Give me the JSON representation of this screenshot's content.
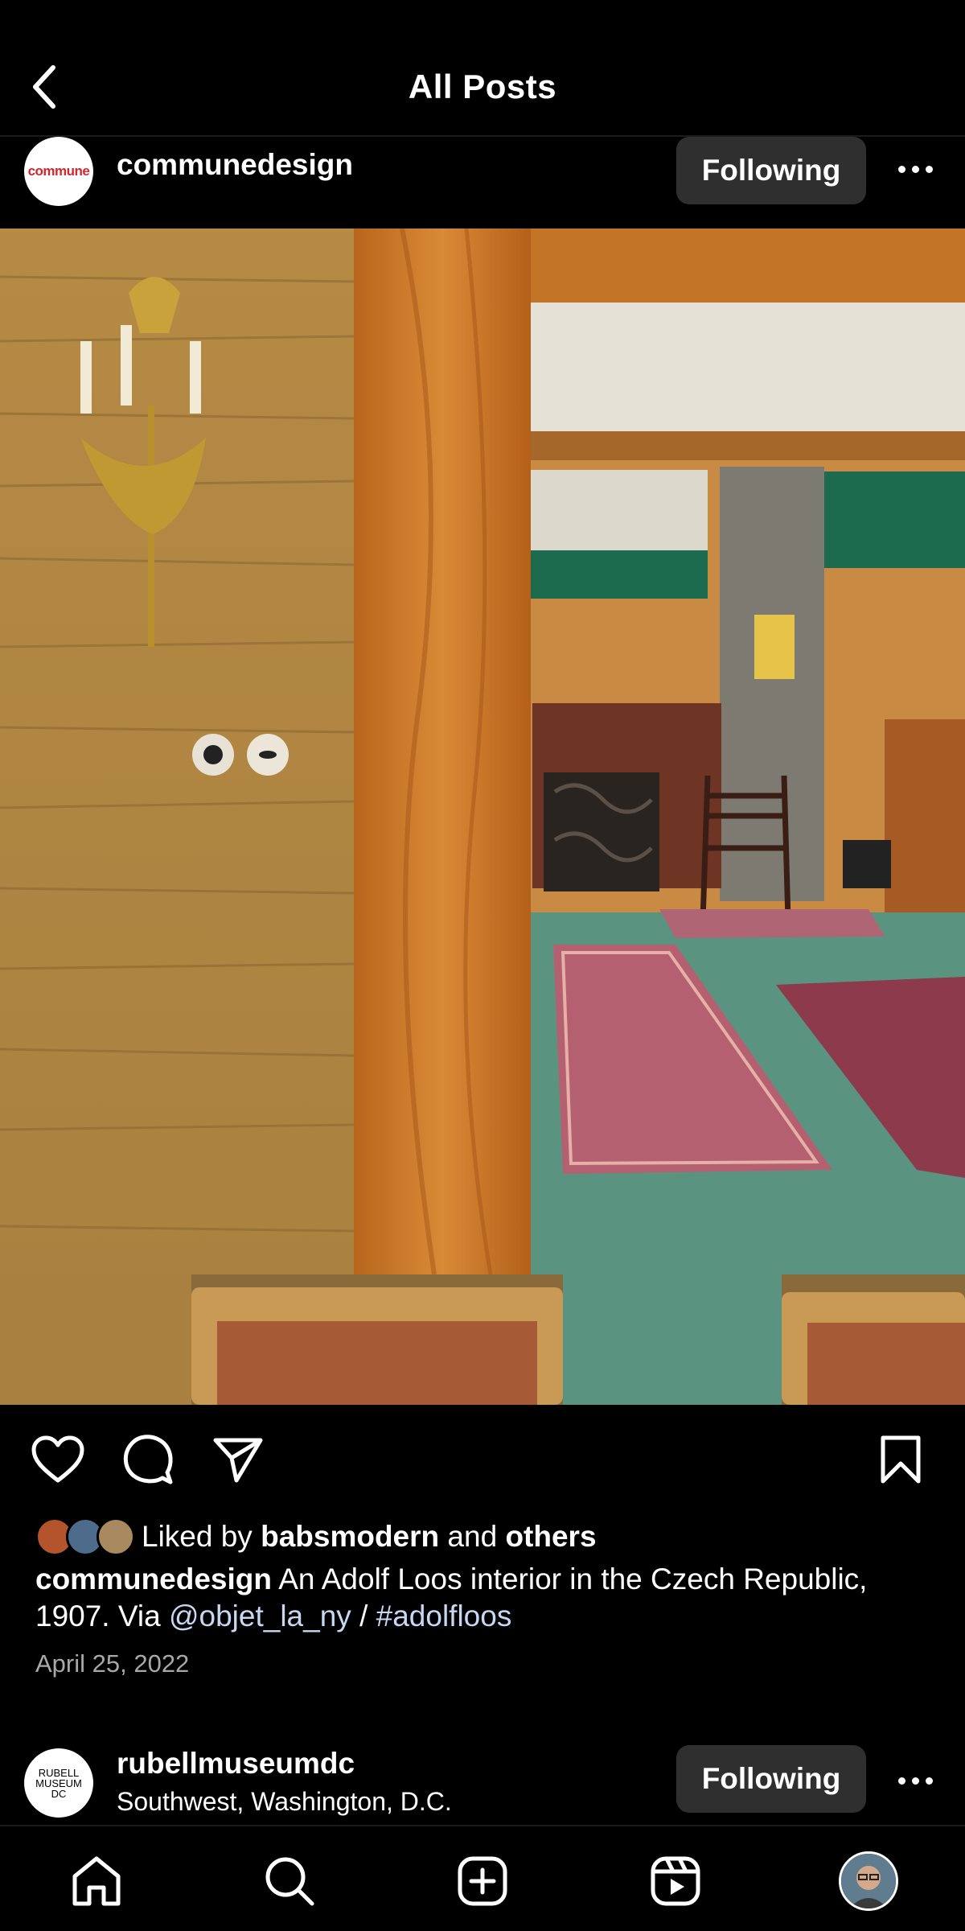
{
  "header": {
    "title": "All Posts"
  },
  "post": {
    "username": "communedesign",
    "avatar_text": "commune",
    "follow_label": "Following",
    "likes": {
      "prefix": "Liked by",
      "user": "babsmodern",
      "joiner": "and",
      "others": "others"
    },
    "caption": {
      "username": "communedesign",
      "text": "An Adolf Loos interior in the Czech Republic, 1907. Via",
      "mention": "@objet_la_ny",
      "separator": "/",
      "hashtag": "#adolfloos"
    },
    "date": "April 25, 2022"
  },
  "next_post": {
    "username": "rubellmuseumdc",
    "location": "Southwest, Washington, D.C.",
    "follow_label": "Following",
    "avatar_lines": [
      "RUBELL",
      "MUSEUM",
      "DC"
    ]
  },
  "icons": {
    "back": "chevron-left-icon",
    "more": "more-icon",
    "like": "heart-icon",
    "comment": "comment-icon",
    "share": "send-icon",
    "save": "bookmark-icon",
    "tabs": [
      "home-icon",
      "search-icon",
      "add-post-icon",
      "reels-icon",
      "profile-avatar"
    ]
  },
  "colors": {
    "background": "#000000",
    "button": "#2f2f2f",
    "link": "#c7d8f2",
    "secondary_text": "#a8a8a8",
    "brand_red": "#d3262e"
  }
}
